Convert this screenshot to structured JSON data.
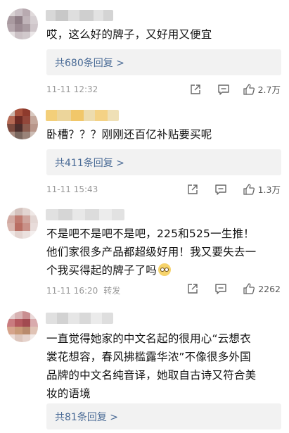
{
  "comments": [
    {
      "text_lines": [
        "哎，这么好的牌子，又好用又便宜"
      ],
      "replies": "共680条回复 >",
      "time": "11-11 12:32",
      "repost": "",
      "likes": "2.7万"
    },
    {
      "text_lines": [
        "卧槽？？？刚刚还百亿补贴要买呢"
      ],
      "replies": "共411条回复 >",
      "time": "11-11 15:43",
      "repost": "",
      "likes": "1.3万"
    },
    {
      "text_lines": [
        "不是吧不是吧不是吧，225和525一生推！",
        "他们家很多产品都超级好用！我又要失去一",
        "个我买得起的牌子了吗"
      ],
      "replies": "",
      "time": "11-11 16:20",
      "repost": "转发",
      "likes": "2262",
      "emoji": "rolling-eyes-emoji"
    },
    {
      "text_lines": [
        "一直觉得她家的中文名起的很用心“云想衣",
        "裳花想容，春风拂槛露华浓”不像很多外国",
        "品牌的中文名纯音译，她取自古诗又符合美",
        "妆的语境"
      ],
      "replies": "共81条回复 >",
      "time": "",
      "repost": "",
      "likes": ""
    }
  ],
  "icons": {
    "share": "share-icon",
    "comment": "comment-icon",
    "like": "thumbs-up-icon"
  },
  "colors": {
    "link_blue": "#4a6b96",
    "meta_gray": "#999999",
    "reply_bg": "#f2f2f2"
  }
}
